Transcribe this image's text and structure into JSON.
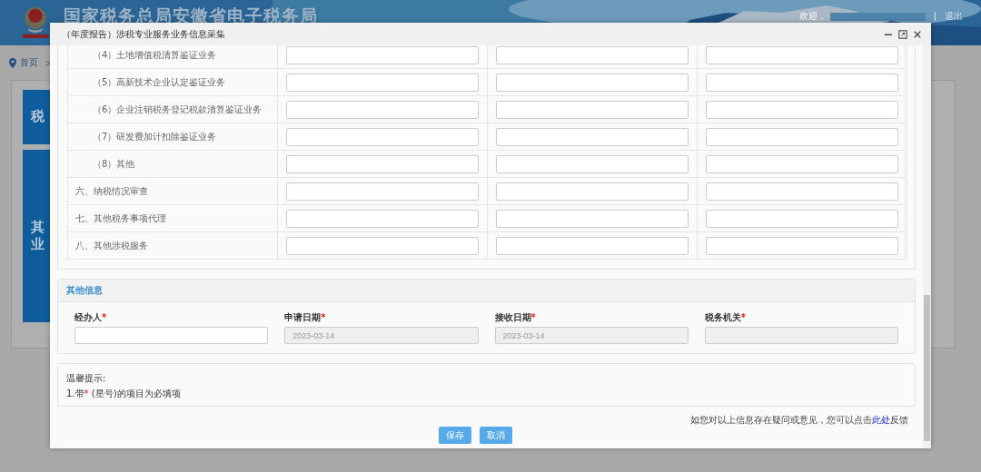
{
  "header": {
    "title": "国家税务总局安徽省电子税务局",
    "welcome": "欢迎，",
    "logout": "退出"
  },
  "breadcrumb": {
    "home": "首页",
    "separator": ">"
  },
  "background_cards": [
    {
      "lines": [
        "税"
      ]
    },
    {
      "lines": [
        "其",
        "业"
      ]
    }
  ],
  "dialog": {
    "title": "（年度报告）涉税专业服务业务信息采集",
    "rows": [
      {
        "label": "（4）土地增值税清算鉴证业务",
        "kind": "sub"
      },
      {
        "label": "（5）高新技术企业认定鉴证业务",
        "kind": "sub"
      },
      {
        "label": "（6）企业注销税务登记税款清算鉴证业务",
        "kind": "sub"
      },
      {
        "label": "（7）研发费加计扣除鉴证业务",
        "kind": "sub"
      },
      {
        "label": "（8）其他",
        "kind": "sub"
      },
      {
        "label": "六、纳税情况审查",
        "kind": "main"
      },
      {
        "label": "七、其他税务事项代理",
        "kind": "main"
      },
      {
        "label": "八、其他涉税服务",
        "kind": "main"
      }
    ]
  },
  "other_info": {
    "title": "其他信息",
    "fields": [
      {
        "label": "经办人",
        "mark": "*",
        "disabled": false
      },
      {
        "label": "申请日期",
        "mark": "*",
        "disabled": true,
        "value": "2023-03-14"
      },
      {
        "label": "接收日期",
        "mark": "*",
        "disabled": true,
        "value": "2023-03-14"
      },
      {
        "label": "税务机关",
        "mark": "*",
        "disabled": true
      }
    ]
  },
  "tips": {
    "title": "温馨提示:",
    "items": [
      {
        "prefix": "1.带",
        "mark": "*",
        "suffix": " (星号)的项目为必填项"
      }
    ]
  },
  "feedback": {
    "before": "如您对以上信息存在疑问或意见，您可以点击",
    "link": "此处",
    "after": "反馈"
  },
  "buttons": [
    {
      "label": "保存"
    },
    {
      "label": "取消"
    }
  ]
}
